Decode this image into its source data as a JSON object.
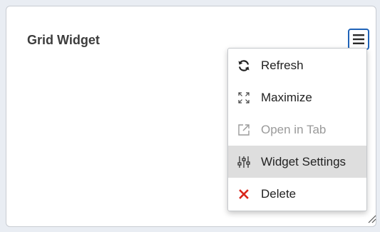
{
  "widget": {
    "title": "Grid Widget"
  },
  "menu": {
    "items": [
      {
        "label": "Refresh",
        "icon": "refresh-icon",
        "state": "normal"
      },
      {
        "label": "Maximize",
        "icon": "maximize-icon",
        "state": "normal"
      },
      {
        "label": "Open in Tab",
        "icon": "open-in-tab-icon",
        "state": "disabled"
      },
      {
        "label": "Widget Settings",
        "icon": "sliders-icon",
        "state": "hovered"
      },
      {
        "label": "Delete",
        "icon": "close-icon",
        "state": "normal"
      }
    ]
  },
  "colors": {
    "menu_button_accent": "#1f63b8",
    "delete_icon": "#d9261c",
    "disabled_text": "#9a9a9a",
    "hover_background": "#dedede"
  }
}
